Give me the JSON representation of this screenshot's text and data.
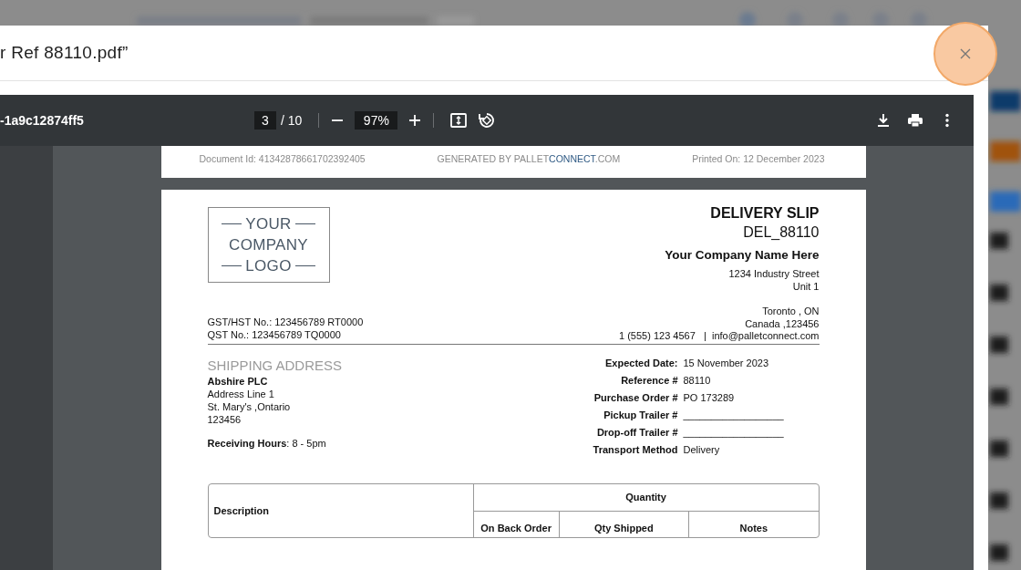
{
  "dialog": {
    "title": "r Ref 88110.pdf”"
  },
  "viewer": {
    "file_name": "-1a9c12874ff5",
    "page_current": "3",
    "page_total": "/ 10",
    "zoom": "97%"
  },
  "previous_page_footer": {
    "document_id": "Document Id: 41342878661702392405",
    "generated_by": [
      {
        "text": "GENERATED BY PALLET",
        "highlight": false
      },
      {
        "text": "CONNECT",
        "highlight": true
      },
      {
        "text": ".COM",
        "highlight": false
      }
    ],
    "printed_on": "Printed On: 12 December 2023"
  },
  "slip": {
    "logo": [
      "YOUR",
      "COMPANY",
      "LOGO"
    ],
    "title": "DELIVERY SLIP",
    "number": "DEL_88110",
    "company": "Your Company Name Here",
    "street": [
      "1234 Industry Street",
      "Unit 1"
    ],
    "city": [
      "Toronto , ON",
      "Canada ,123456"
    ],
    "tax_lines": [
      "GST/HST No.: 123456789 RT0000",
      "QST No.: 123456789 TQ0000"
    ],
    "phone": "1 (555) 123 4567",
    "separator": "|",
    "email": "info@palletconnect.com",
    "shipping": {
      "heading": "SHIPPING ADDRESS",
      "name": "Abshire PLC",
      "lines": [
        "Address Line 1",
        "St. Mary's ,Ontario",
        "123456"
      ],
      "receiving_hours": "**Receiving Hours**: 8 - 5pm"
    },
    "details": [
      {
        "label": "Expected Date:",
        "value": "15 November 2023"
      },
      {
        "label": "Reference #",
        "value": "88110"
      },
      {
        "label": "Purchase Order #",
        "value": "PO 173289"
      },
      {
        "label": "Pickup Trailer #",
        "value": "__________________"
      },
      {
        "label": "Drop-off Trailer #",
        "value": "__________________"
      },
      {
        "label": "Transport Method",
        "value": "Delivery"
      }
    ],
    "table": {
      "description": "Description",
      "quantity": "Quantity",
      "columns": [
        "On Back Order",
        "Qty Shipped",
        "Notes"
      ]
    }
  }
}
